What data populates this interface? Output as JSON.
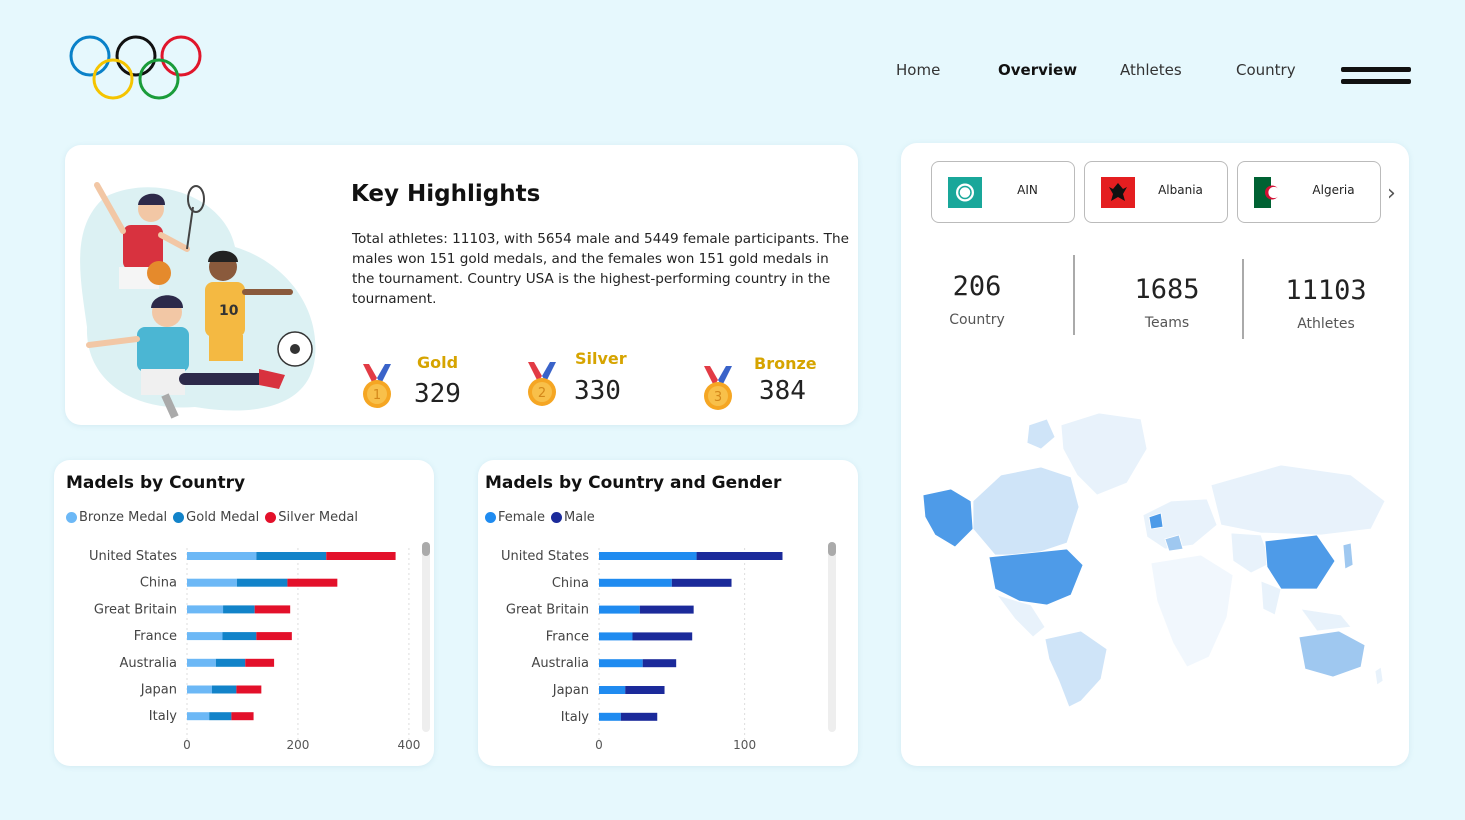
{
  "nav": {
    "items": [
      {
        "label": "Home",
        "active": false
      },
      {
        "label": "Overview",
        "active": true
      },
      {
        "label": "Athletes",
        "active": false
      },
      {
        "label": "Country",
        "active": false
      }
    ]
  },
  "highlights": {
    "title": "Key Highlights",
    "text": "Total athletes: 11103, with 5654 male and 5449 female participants. The males won 151 gold medals, and the females won 151 gold medals in the tournament. Country USA is the highest-performing country in the tournament.",
    "medals": [
      {
        "label": "Gold",
        "value": "329",
        "number": "1"
      },
      {
        "label": "Silver",
        "value": "330",
        "number": "2"
      },
      {
        "label": "Bronze",
        "value": "384",
        "number": "3"
      }
    ]
  },
  "countries": {
    "buttons": [
      {
        "name": "AIN",
        "icon": "ain-flag-icon"
      },
      {
        "name": "Albania",
        "icon": "albania-flag-icon"
      },
      {
        "name": "Algeria",
        "icon": "algeria-flag-icon"
      }
    ]
  },
  "stats": [
    {
      "value": "206",
      "label": "Country"
    },
    {
      "value": "1685",
      "label": "Teams"
    },
    {
      "value": "11103",
      "label": "Athletes"
    }
  ],
  "colors": {
    "bronze": "#6cb8f6",
    "gold": "#1283c9",
    "silver": "#e3102a",
    "female": "#1f8bf0",
    "male": "#1b2a9a",
    "medal_label": "#d6a400"
  },
  "chart_data": [
    {
      "type": "bar",
      "orientation": "horizontal",
      "stacked": true,
      "title": "Madels by Country",
      "categories": [
        "United States",
        "China",
        "Great Britain",
        "France",
        "Australia",
        "Japan",
        "Italy"
      ],
      "series": [
        {
          "name": "Bronze Medal",
          "values": [
            125,
            90,
            65,
            64,
            52,
            45,
            40
          ]
        },
        {
          "name": "Gold Medal",
          "values": [
            126,
            91,
            57,
            61,
            53,
            44,
            40
          ]
        },
        {
          "name": "Silver Medal",
          "values": [
            125,
            90,
            64,
            64,
            52,
            45,
            40
          ]
        }
      ],
      "xlim": [
        0,
        420
      ],
      "xticks": [
        0,
        200,
        400
      ],
      "legend": "top-left"
    },
    {
      "type": "bar",
      "orientation": "horizontal",
      "stacked": true,
      "title": "Madels by Country and Gender",
      "categories": [
        "United States",
        "China",
        "Great Britain",
        "France",
        "Australia",
        "Japan",
        "Italy"
      ],
      "series": [
        {
          "name": "Female",
          "values": [
            67,
            50,
            28,
            23,
            30,
            18,
            15
          ]
        },
        {
          "name": "Male",
          "values": [
            59,
            41,
            37,
            41,
            23,
            27,
            25
          ]
        }
      ],
      "xlim": [
        0,
        160
      ],
      "xticks": [
        0,
        100
      ],
      "legend": "top-left"
    }
  ]
}
